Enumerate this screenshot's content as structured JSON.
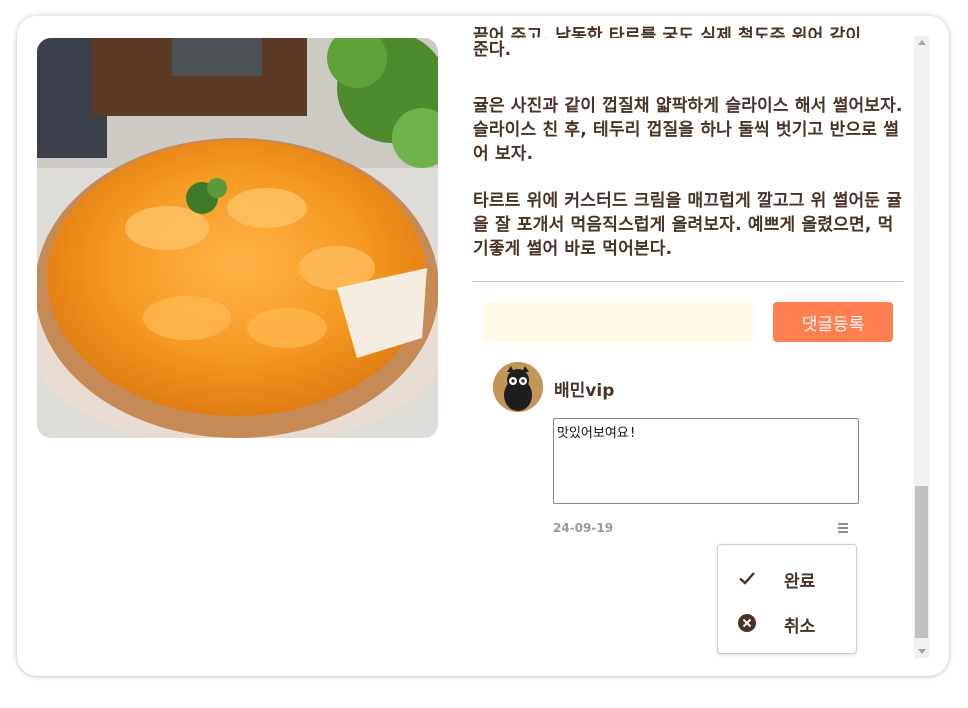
{
  "post": {
    "paragraphs": [
      "준다.",
      "귤은 사진과 같이 껍질채 얇팍하게 슬라이스 해서 썰어보자. 슬라이스 친 후, 테두리 껍질을 하나 둘씩 벗기고 반으로 썰 어 보자.",
      "타르트 위에 커스터드 크림을 매끄럽게 깔고그 위 썰어둔 귤을 잘 포개서 먹음직스럽게 올려보자. 예쁘게 올렸으면, 먹기좋게 썰어 바로 먹어본다."
    ],
    "cut_line": "끝어 주고, 남동한 타르를 궁도 심제 철도주 위어 같이"
  },
  "comment_form": {
    "input_value": "",
    "input_placeholder": "",
    "submit_label": "댓글등록"
  },
  "comment": {
    "username": "배민vip",
    "edit_text": "맛있어보여요!",
    "date": "24-09-19",
    "menu": [
      {
        "label": "완료",
        "icon": "check-icon"
      },
      {
        "label": "취소",
        "icon": "cancel-circle-icon"
      }
    ]
  },
  "colors": {
    "accent": "#ff7f50",
    "text": "#4a3226",
    "input_bg": "#fff9e8"
  }
}
